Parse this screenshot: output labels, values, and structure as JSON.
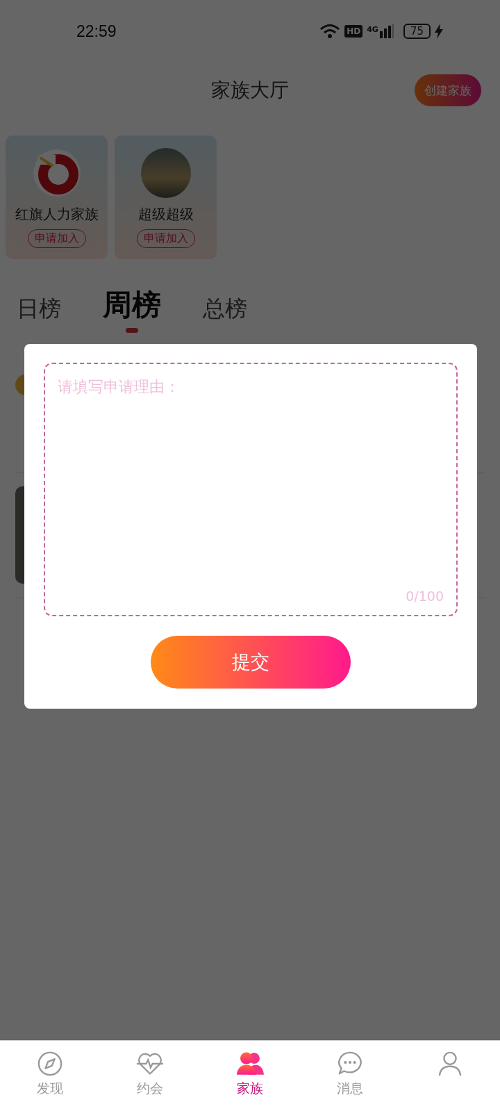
{
  "status_bar": {
    "time": "22:59",
    "hd": "HD",
    "network": "4G",
    "battery": "75"
  },
  "header": {
    "title": "家族大厅",
    "create_button": "创建家族"
  },
  "families": [
    {
      "name": "红旗人力家族",
      "join_button": "申请加入",
      "kind": "logo"
    },
    {
      "name": "超级超级",
      "join_button": "申请加入",
      "kind": "photo"
    }
  ],
  "ranking_tabs": [
    {
      "label": "日榜",
      "selected": false
    },
    {
      "label": "周榜",
      "selected": true
    },
    {
      "label": "总榜",
      "selected": false
    }
  ],
  "dialog": {
    "placeholder": "请填写申请理由：",
    "counter": "0/100",
    "submit_button": "提交"
  },
  "nav": [
    {
      "label": "发现",
      "kind": "compass",
      "selected": false
    },
    {
      "label": "约会",
      "kind": "heart",
      "selected": false
    },
    {
      "label": "家族",
      "kind": "people",
      "selected": true
    },
    {
      "label": "消息",
      "kind": "chat",
      "selected": false
    },
    {
      "kind": "person",
      "selected": false
    }
  ]
}
